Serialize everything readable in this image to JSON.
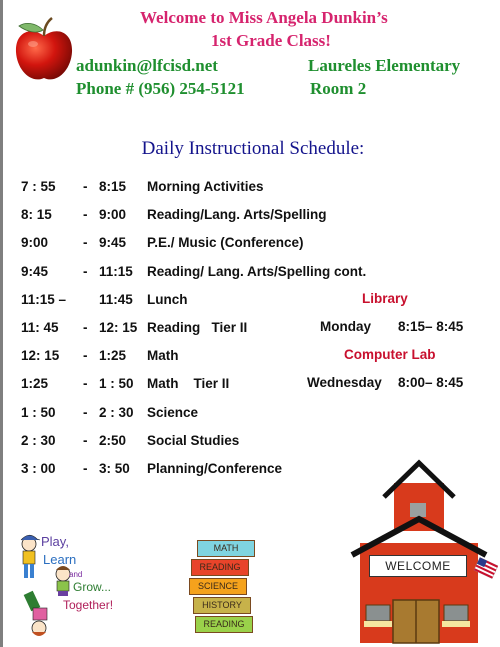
{
  "header": {
    "welcome_line1": "Welcome to Miss Angela Dunkin’s",
    "welcome_line2": "1st Grade Class!",
    "email": "adunkin@lfcisd.net",
    "phone": "Phone # (956) 254-5121",
    "school": "Laureles Elementary",
    "room": "Room 2"
  },
  "schedule": {
    "title": "Daily Instructional Schedule:",
    "rows": [
      {
        "start": "7 : 55",
        "sep": "-",
        "end": "8:15",
        "activity": "Morning Activities"
      },
      {
        "start": "8: 15",
        "sep": "-",
        "end": "9:00",
        "activity": "Reading/Lang. Arts/Spelling"
      },
      {
        "start": "9:00",
        "sep": "-",
        "end": "9:45",
        "activity": "P.E./ Music (Conference)"
      },
      {
        "start": "9:45",
        "sep": "-",
        "end": "11:15",
        "activity": "Reading/ Lang. Arts/Spelling cont."
      },
      {
        "start": "11:15 –",
        "sep": "",
        "end": "11:45",
        "activity": "Lunch"
      },
      {
        "start": "11: 45",
        "sep": "-",
        "end": "12: 15",
        "activity": "Reading   Tier II"
      },
      {
        "start": "12: 15",
        "sep": "-",
        "end": "1:25",
        "activity": "Math"
      },
      {
        "start": "1:25",
        "sep": "-",
        "end": "1 : 50",
        "activity": "Math    Tier II"
      },
      {
        "start": "1 : 50",
        "sep": "-",
        "end": "2 : 30",
        "activity": "Science"
      },
      {
        "start": "2 : 30",
        "sep": "-",
        "end": "2:50",
        "activity": "Social Studies"
      },
      {
        "start": "3 : 00",
        "sep": "-",
        "end": "3: 50",
        "activity": "Planning/Conference"
      }
    ]
  },
  "specials": {
    "library_label": "Library",
    "library_day": "Monday",
    "library_time": "8:15– 8:45",
    "lab_label": "Computer Lab",
    "lab_day": "Wednesday",
    "lab_time": "8:00– 8:45"
  },
  "images": {
    "play_text": [
      "Play,",
      "Learn",
      "and",
      "Grow...",
      "Together!"
    ],
    "books": [
      "MATH",
      "READING",
      "SCIENCE",
      "HISTORY",
      "READING"
    ],
    "school_sign": "WELCOME"
  },
  "colors": {
    "welcome": "#d6246e",
    "contact": "#1f8f2f",
    "title": "#14148c",
    "specials": "#c8102e"
  }
}
